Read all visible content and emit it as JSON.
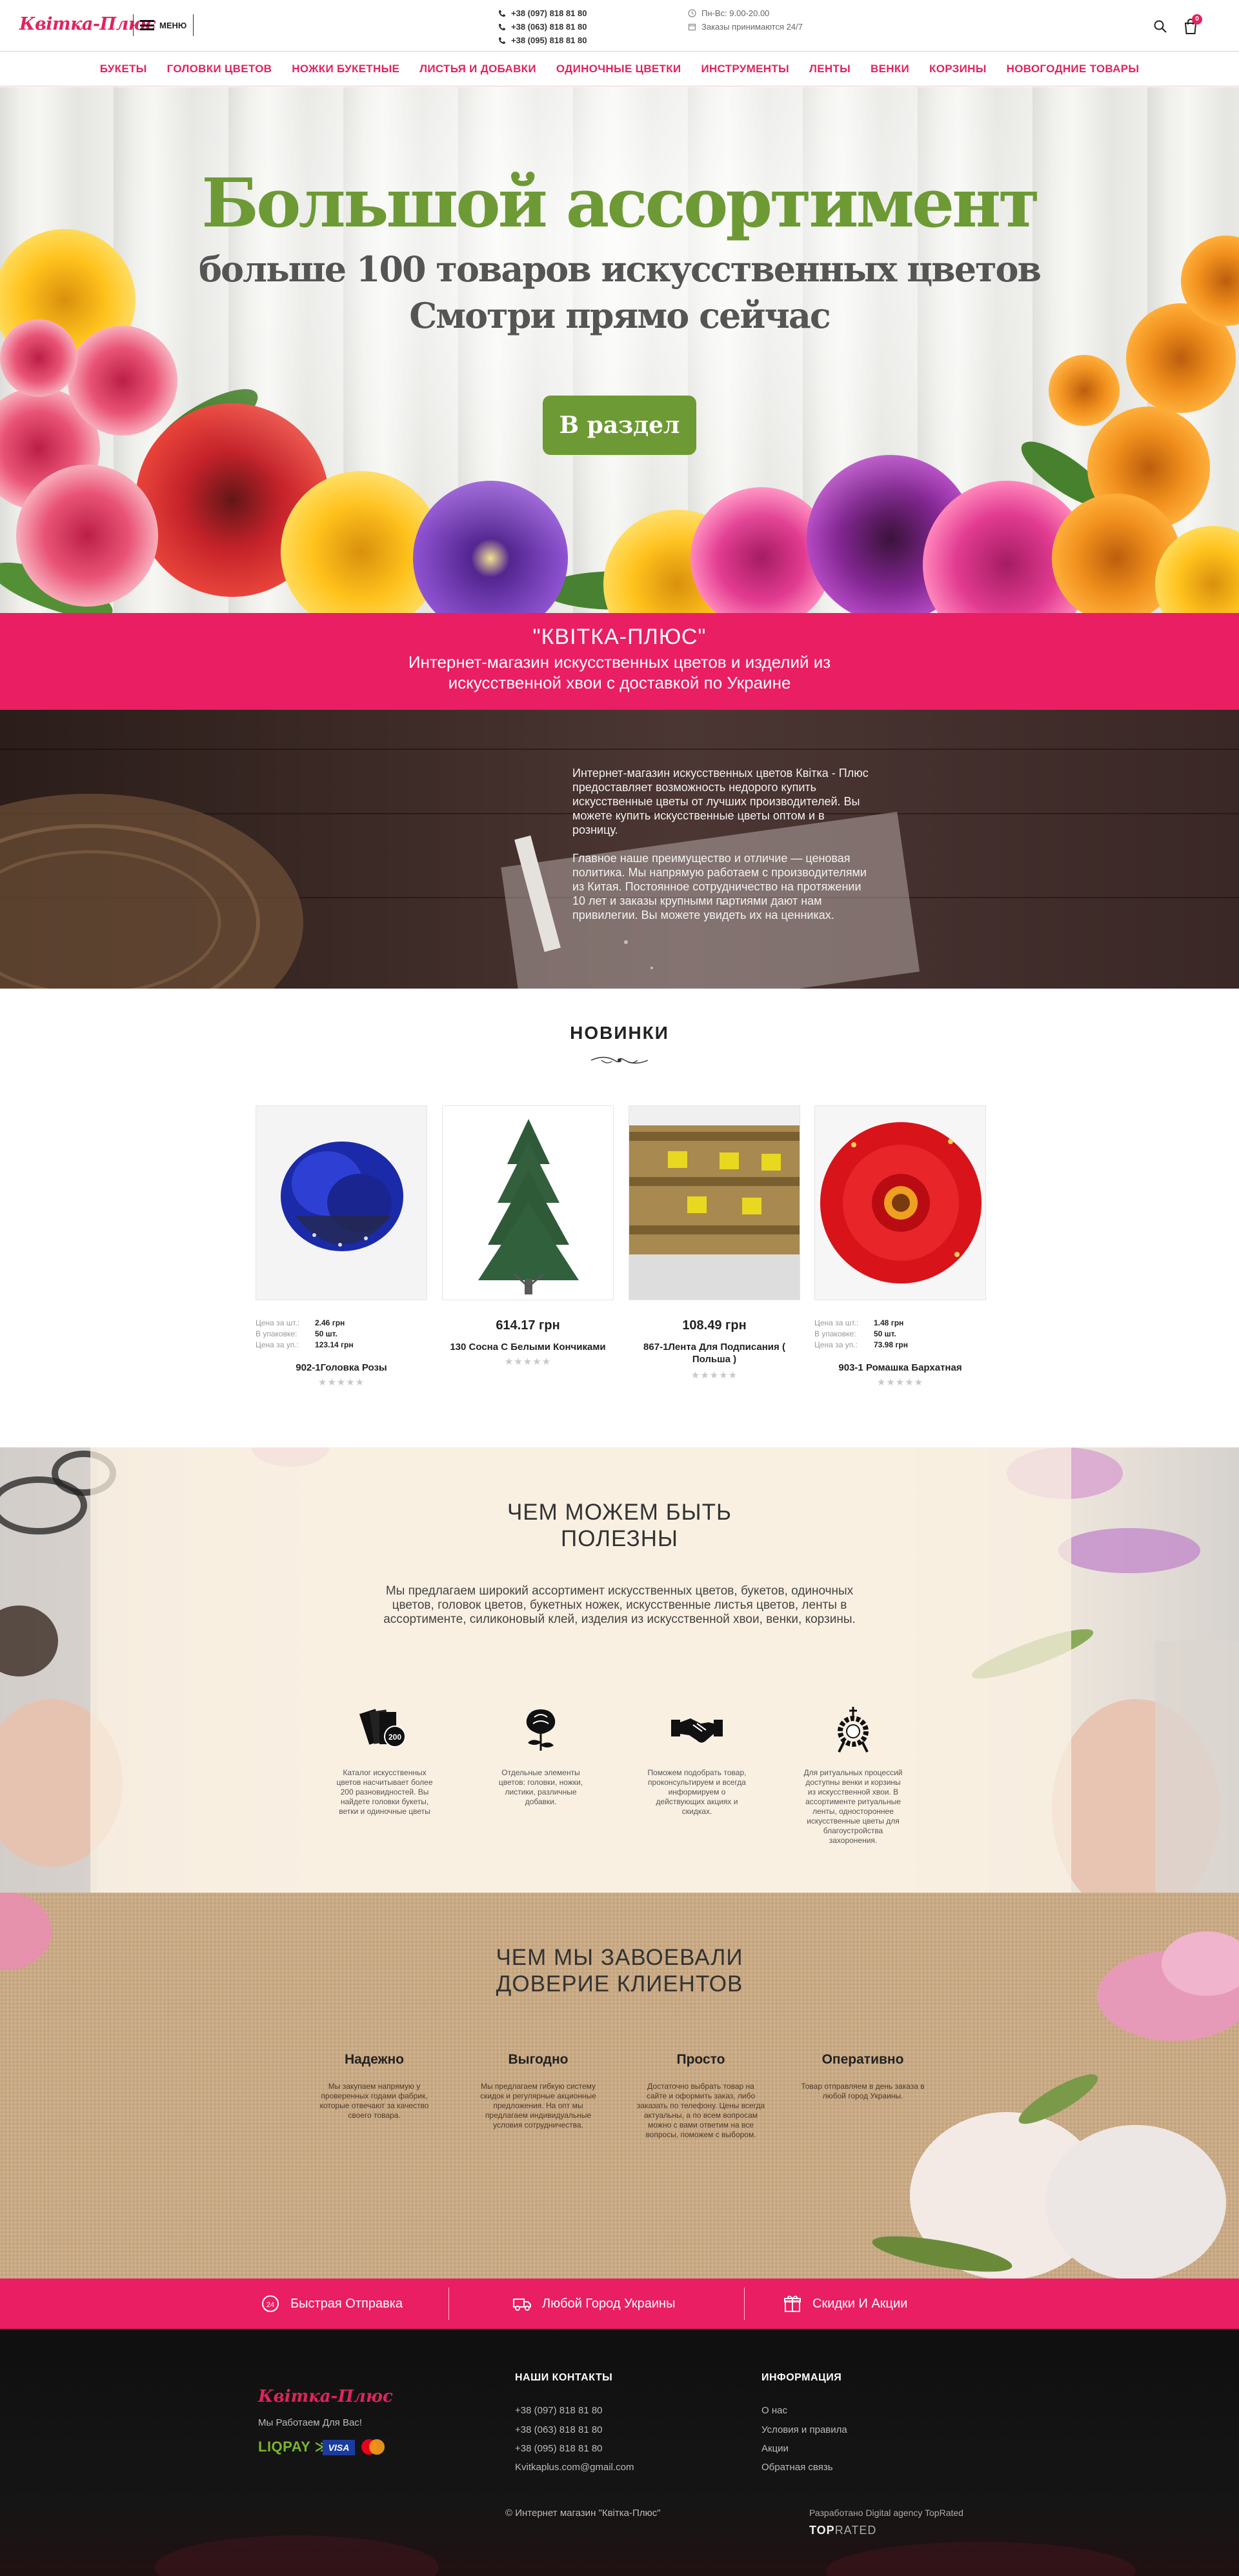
{
  "header": {
    "logo": "Квітка-Плюс",
    "menu_label": "МЕНЮ",
    "phones": [
      "+38 (097) 818 81 80",
      "+38 (063) 818 81 80",
      "+38 (095) 818 81 80"
    ],
    "hours": "Пн-Вс: 9.00-20.00",
    "orders_note": "Заказы принимаются 24/7",
    "cart_count": "0"
  },
  "nav": {
    "items": [
      "БУКЕТЫ",
      "ГОЛОВКИ ЦВЕТОВ",
      "НОЖКИ БУКЕТНЫЕ",
      "ЛИСТЬЯ И ДОБАВКИ",
      "ОДИНОЧНЫЕ ЦВЕТКИ",
      "ИНСТРУМЕНТЫ",
      "ЛЕНТЫ",
      "ВЕНКИ",
      "КОРЗИНЫ",
      "НОВОГОДНИЕ ТОВАРЫ"
    ]
  },
  "hero": {
    "title": "Большой ассортимент",
    "subtitle1": "больше 100 товаров искусственных цветов",
    "subtitle2": "Смотри прямо сейчас",
    "button": "В раздел"
  },
  "intro": {
    "title": "\"КВІТКА-ПЛЮС\"",
    "text": "Интернет-магазин искусственных цветов и изделий из искусственной хвои с доставкой по Украине"
  },
  "about": {
    "p1": "Интернет-магазин искусственных цветов Квітка - Плюс предоставляет возможность недорого купить искусственные цветы от лучших производителей. Вы можете купить искусственные цветы оптом и в розницу.",
    "p2": "Главное наше преимущество и отличие — ценовая политика. Мы напрямую работаем с производителями из Китая. Постоянное сотрудничество на протяжении 10 лет и заказы крупными партиями дают нам привилегии. Вы можете увидеть их на ценниках."
  },
  "new_products": {
    "title": "НОВИНКИ",
    "items": [
      {
        "name": "902-1Головка Розы",
        "spec": [
          {
            "k": "Цена за шт.:",
            "v": "2.46 грн"
          },
          {
            "k": "В упаковке:",
            "v": "50 шт."
          },
          {
            "k": "Цена за уп.:",
            "v": "123.14 грн"
          }
        ],
        "rating": "★★★★★"
      },
      {
        "name": "130 Сосна С Белыми Кончиками",
        "price": "614.17 грн",
        "rating": "★★★★★"
      },
      {
        "name": "867-1Лента Для Подписания ( Польша )",
        "price": "108.49 грн",
        "rating": "★★★★★"
      },
      {
        "name": "903-1 Ромашка Бархатная",
        "spec": [
          {
            "k": "Цена за шт.:",
            "v": "1.48 грн"
          },
          {
            "k": "В упаковке:",
            "v": "50 шт."
          },
          {
            "k": "Цена за уп.:",
            "v": "73.98 грн"
          }
        ],
        "rating": "★★★★★"
      }
    ]
  },
  "useful": {
    "title_line1": "ЧЕМ МОЖЕМ БЫТЬ",
    "title_line2": "ПОЛЕЗНЫ",
    "text": "Мы предлагаем широкий ассортимент искусственных цветов, букетов, одиночных цветов, головок цветов, букетных ножек, искусственные листья цветов, ленты в ассортименте, силиконовый клей, изделия из искусственной хвои, венки, корзины.",
    "features": [
      {
        "icon": "catalog-cards-icon",
        "badge": "200",
        "text": "Каталог искусственных цветов насчитывает более 200 разновидностей. Вы найдете головки букеты, ветки и одиночные цветы"
      },
      {
        "icon": "rose-icon",
        "text": "Отдельные элементы цветов: головки, ножки, листики, различные добавки."
      },
      {
        "icon": "handshake-icon",
        "text": "Поможем подобрать товар, проконсультируем и всегда информируем о действующих акциях и скидках."
      },
      {
        "icon": "wreath-icon",
        "text": "Для ритуальных процессий доступны венки и корзины из искусственной хвои. В ассортименте ритуальные ленты, одностороннее искусственные цветы для благоустройства захоронения."
      }
    ]
  },
  "trust": {
    "title_line1": "ЧЕМ МЫ ЗАВОЕВАЛИ",
    "title_line2": "ДОВЕРИЕ КЛИЕНТОВ",
    "items": [
      {
        "title": "Надежно",
        "text": "Мы закупаем напрямую у проверенных годами фабрик, которые отвечают за качество своего товара."
      },
      {
        "title": "Выгодно",
        "text": "Мы предлагаем гибкую систему скидок и регулярные акционные предложения. На опт мы предлагаем индивидуальные условия сотрудничества."
      },
      {
        "title": "Просто",
        "text": "Достаточно выбрать товар на сайте и оформить заказ, либо заказать по телефону. Цены всегда актуальны, а по всем вопросам можно с вами ответим на все вопросы, поможем с выбором."
      },
      {
        "title": "Оперативно",
        "text": "Товар отправляем в день заказа в любой город Украины."
      }
    ]
  },
  "perks": {
    "items": [
      {
        "icon": "24h-icon",
        "text": "Быстрая Отправка"
      },
      {
        "icon": "truck-icon",
        "text": "Любой Город Украины"
      },
      {
        "icon": "gift-icon",
        "text": "Скидки И Акции"
      }
    ]
  },
  "footer": {
    "logo": "Квітка-Плюс",
    "slogan": "Мы Работаем Для Вас!",
    "liqpay": "LIQPAY",
    "visa": "VISA",
    "contacts_title": "НАШИ КОНТАКТЫ",
    "contacts": [
      "+38 (097) 818 81 80",
      "+38 (063) 818 81 80",
      "+38 (095) 818 81 80",
      "Kvitkaplus.com@gmail.com"
    ],
    "info_title": "ИНФОРМАЦИЯ",
    "info_links": [
      "О нас",
      "Условия и правила",
      "Акции",
      "Обратная связь"
    ],
    "copyright": "© Интернет магазин \"Квітка-Плюс\"",
    "dev_credit": "Разработано Digital agency TopRated",
    "dev_logo_a": "TOP",
    "dev_logo_b": "RATED"
  },
  "colors": {
    "accent": "#e91e63",
    "green": "#6d9a34",
    "dark": "#1b1b1b"
  }
}
